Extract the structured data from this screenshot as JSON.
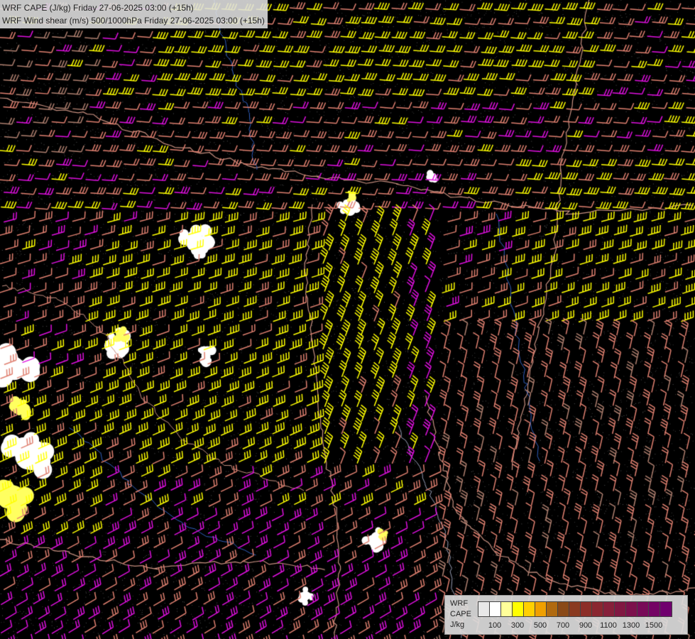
{
  "titles": {
    "line1": "WRF CAPE (J/kg) Friday 27-06-2025 03:00 (+15h)",
    "line2": "WRF Wind shear (m/s) 500/1000hPa Friday 27-06-2025 03:00 (+15h)"
  },
  "legend": {
    "label_line1": "WRF",
    "label_line2": "CAPE",
    "label_line3": "J/kg",
    "swatch_colors": [
      "#e8e8e8",
      "#ffffff",
      "#ffff9a",
      "#ffff00",
      "#ffd000",
      "#f0a000",
      "#b06a10",
      "#8a4a18",
      "#8a3a20",
      "#8c2e28",
      "#8a2630",
      "#86203a",
      "#801842",
      "#7c104c",
      "#780a58",
      "#740464",
      "#70006e"
    ],
    "ticks": [
      "100",
      "300",
      "500",
      "700",
      "900",
      "1100",
      "1300",
      "1500"
    ]
  },
  "colors": {
    "background": "#000000",
    "barb_yellow": "#ffff00",
    "barb_salmon": "#e08070",
    "barb_magenta": "#e010e0",
    "barb_brown": "#b08070",
    "border_line": "#c89080",
    "river_line": "#3060c0",
    "cape_white": "#ffffff",
    "cape_yellow": "#ffff60"
  }
}
